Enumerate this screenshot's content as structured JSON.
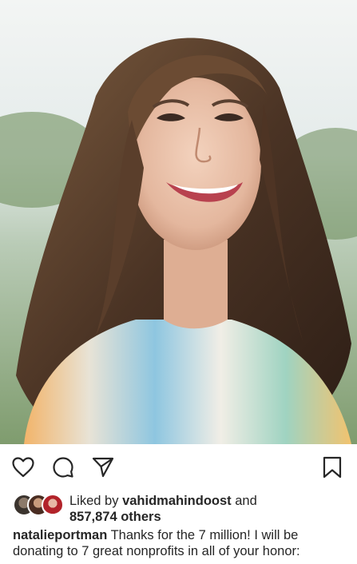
{
  "post": {
    "image_alt": "Smiling woman with long wavy hair outdoors",
    "liked_by_prefix": "Liked by",
    "liked_by_user": "vahidmahindoost",
    "liked_by_and": "and",
    "others_count": "857,874 others",
    "caption_user": "natalieportman",
    "caption_text": "Thanks for the 7 million! I will be donating to 7 great nonprofits in all of your honor:"
  },
  "actions": {
    "like_icon": "heart-icon",
    "comment_icon": "comment-icon",
    "share_icon": "share-icon",
    "save_icon": "bookmark-icon"
  },
  "colors": {
    "text": "#262626",
    "icon": "#262626"
  }
}
